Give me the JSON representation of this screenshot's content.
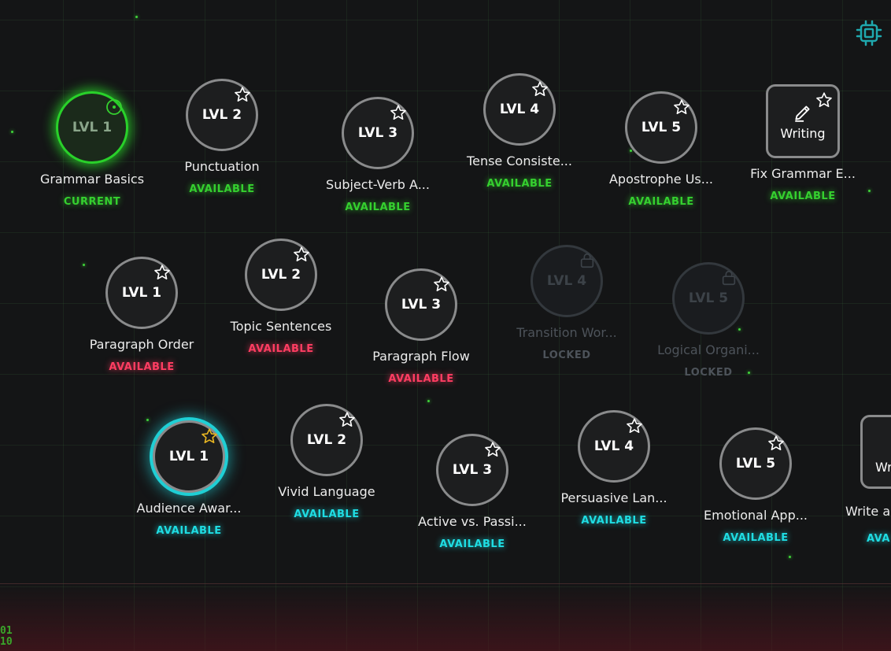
{
  "background": {
    "binary_lines": [
      "01",
      "10"
    ]
  },
  "colors": {
    "green": "#35d02f",
    "red": "#ff3d62",
    "cyan": "#1fdde3",
    "gold": "#e6b422",
    "locked": "#4d535a"
  },
  "icons": {
    "settings": "chip-icon",
    "star": "star-icon",
    "lock": "lock-icon",
    "pencil": "pencil-icon"
  },
  "rows": [
    {
      "nodes": [
        {
          "level": "LVL 1",
          "title": "Grammar Basics",
          "status": "CURRENT"
        },
        {
          "level": "LVL 2",
          "title": "Punctuation",
          "status": "AVAILABLE"
        },
        {
          "level": "LVL 3",
          "title": "Subject-Verb A...",
          "status": "AVAILABLE"
        },
        {
          "level": "LVL 4",
          "title": "Tense Consiste...",
          "status": "AVAILABLE"
        },
        {
          "level": "LVL 5",
          "title": "Apostrophe Us...",
          "status": "AVAILABLE"
        },
        {
          "level": "Writing",
          "title": "Fix Grammar E...",
          "status": "AVAILABLE"
        }
      ]
    },
    {
      "nodes": [
        {
          "level": "LVL 1",
          "title": "Paragraph Order",
          "status": "AVAILABLE"
        },
        {
          "level": "LVL 2",
          "title": "Topic Sentences",
          "status": "AVAILABLE"
        },
        {
          "level": "LVL 3",
          "title": "Paragraph Flow",
          "status": "AVAILABLE"
        },
        {
          "level": "LVL 4",
          "title": "Transition Wor...",
          "status": "LOCKED"
        },
        {
          "level": "LVL 5",
          "title": "Logical Organi...",
          "status": "LOCKED"
        }
      ]
    },
    {
      "nodes": [
        {
          "level": "LVL 1",
          "title": "Audience Awar...",
          "status": "AVAILABLE"
        },
        {
          "level": "LVL 2",
          "title": "Vivid Language",
          "status": "AVAILABLE"
        },
        {
          "level": "LVL 3",
          "title": "Active vs. Passi...",
          "status": "AVAILABLE"
        },
        {
          "level": "LVL 4",
          "title": "Persuasive Lan...",
          "status": "AVAILABLE"
        },
        {
          "level": "LVL 5",
          "title": "Emotional App...",
          "status": "AVAILABLE"
        },
        {
          "level": "Wr",
          "title": "Write a",
          "status": "AVA"
        }
      ]
    }
  ]
}
